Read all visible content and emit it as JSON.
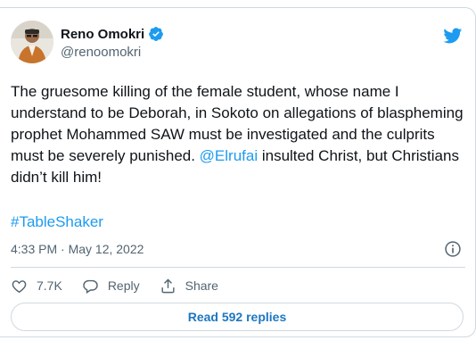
{
  "author": {
    "name": "Reno Omokri",
    "handle": "@renoomokri"
  },
  "tweet": {
    "text_before_mention": "The gruesome killing of the female student, whose name I understand to be Deborah, in Sokoto on allegations of blaspheming prophet Mohammed SAW must be investigated and the culprits must be severely punished. ",
    "mention": "@Elrufai",
    "text_after_mention": " insulted Christ, but Christians didn’t kill him!",
    "hashtag": "#TableShaker",
    "timestamp": "4:33 PM · May 12, 2022"
  },
  "actions": {
    "like_count": "7.7K",
    "reply_label": "Reply",
    "share_label": "Share"
  },
  "read_replies_label": "Read 592 replies",
  "colors": {
    "accent": "#1d9bf0",
    "text": "#0f1419",
    "muted": "#536471",
    "border": "#cfd9de"
  }
}
